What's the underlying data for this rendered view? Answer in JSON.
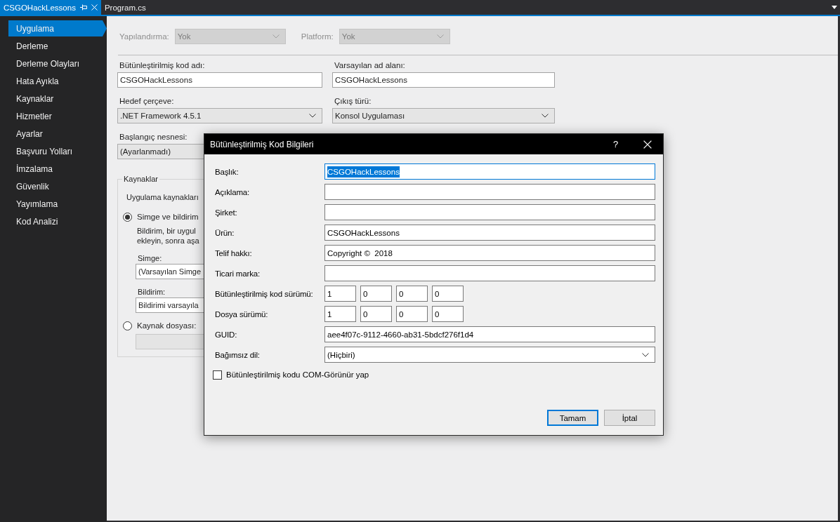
{
  "document_tabs": [
    {
      "label": "CSGOHackLessons",
      "selected": true
    },
    {
      "label": "Program.cs",
      "selected": false
    }
  ],
  "sidebar": {
    "items": [
      {
        "label": "Uygulama",
        "selected": true
      },
      {
        "label": "Derleme",
        "selected": false
      },
      {
        "label": "Derleme Olayları",
        "selected": false
      },
      {
        "label": "Hata Ayıkla",
        "selected": false
      },
      {
        "label": "Kaynaklar",
        "selected": false
      },
      {
        "label": "Hizmetler",
        "selected": false
      },
      {
        "label": "Ayarlar",
        "selected": false
      },
      {
        "label": "Başvuru Yolları",
        "selected": false
      },
      {
        "label": "İmzalama",
        "selected": false
      },
      {
        "label": "Güvenlik",
        "selected": false
      },
      {
        "label": "Yayımlama",
        "selected": false
      },
      {
        "label": "Kod Analizi",
        "selected": false
      }
    ]
  },
  "configuration": [
    {
      "label": "Yapılandırma:",
      "value": "Yok",
      "disabled": true
    },
    {
      "label": "Platform:",
      "value": "Yok",
      "disabled": true
    }
  ],
  "application": {
    "fields": [
      {
        "label": "Bütünleştirilmiş kod adı:",
        "kind": "text",
        "value": "CSGOHackLessons"
      },
      {
        "label": "Varsayılan ad alanı:",
        "kind": "text",
        "value": "CSGOHackLessons"
      },
      {
        "label": "Hedef çerçeve:",
        "kind": "select",
        "value": ".NET Framework 4.5.1"
      },
      {
        "label": "Çıkış türü:",
        "kind": "select",
        "value": "Konsol Uygulaması"
      }
    ],
    "startup_object": {
      "label": "Başlangıç nesnesi:",
      "value": "(Ayarlanmadı)"
    }
  },
  "resources": {
    "title": "Kaynaklar",
    "intro": "Uygulama kaynakları",
    "options": [
      {
        "label": "Simge ve bildirim",
        "selected": true,
        "description": [
          "Bildirim, bir uygul",
          "ekleyin, sonra aşa"
        ],
        "fields": [
          {
            "label": "Simge:",
            "value": "(Varsayılan Simge",
            "disabled": false
          },
          {
            "label": "Bildirim:",
            "value": "Bildirimi varsayıla",
            "disabled": false
          }
        ]
      },
      {
        "label": "Kaynak dosyası:",
        "selected": false,
        "fields": [
          {
            "disabled": true
          }
        ]
      }
    ]
  },
  "dialog": {
    "title": "Bütünleştirilmiş Kod Bilgileri",
    "help": "?",
    "fields": [
      {
        "kind": "text",
        "label": "Başlık:",
        "value": "CSGOHackLessons",
        "focused": true
      },
      {
        "kind": "text",
        "label": "Açıklama:",
        "focused": false
      },
      {
        "kind": "text",
        "label": "Şirket:",
        "focused": false
      },
      {
        "kind": "text",
        "label": "Ürün:",
        "value": "CSGOHackLessons",
        "focused": false
      },
      {
        "kind": "text",
        "label": "Telif hakkı:",
        "value": "Copyright ©  2018",
        "focused": false
      },
      {
        "kind": "text",
        "label": "Ticari marka:",
        "focused": false
      },
      {
        "kind": "version",
        "label": "Bütünleştirilmiş kod sürümü:",
        "parts": [
          "1",
          "0",
          "0",
          "0"
        ]
      },
      {
        "kind": "version",
        "label": "Dosya sürümü:",
        "parts": [
          "1",
          "0",
          "0",
          "0"
        ]
      },
      {
        "kind": "text",
        "label": "GUID:",
        "value": "aee4f07c-9112-4660-ab31-5bdcf276f1d4",
        "focused": false
      },
      {
        "kind": "select",
        "label": "Bağımsız dil:",
        "value": "(Hiçbiri)"
      }
    ],
    "com_visible": {
      "label": "Bütünleştirilmiş kodu COM-Görünür yap",
      "checked": false
    },
    "buttons": [
      {
        "label": "Tamam",
        "default": true
      },
      {
        "label": "İptal",
        "default": false
      }
    ]
  }
}
